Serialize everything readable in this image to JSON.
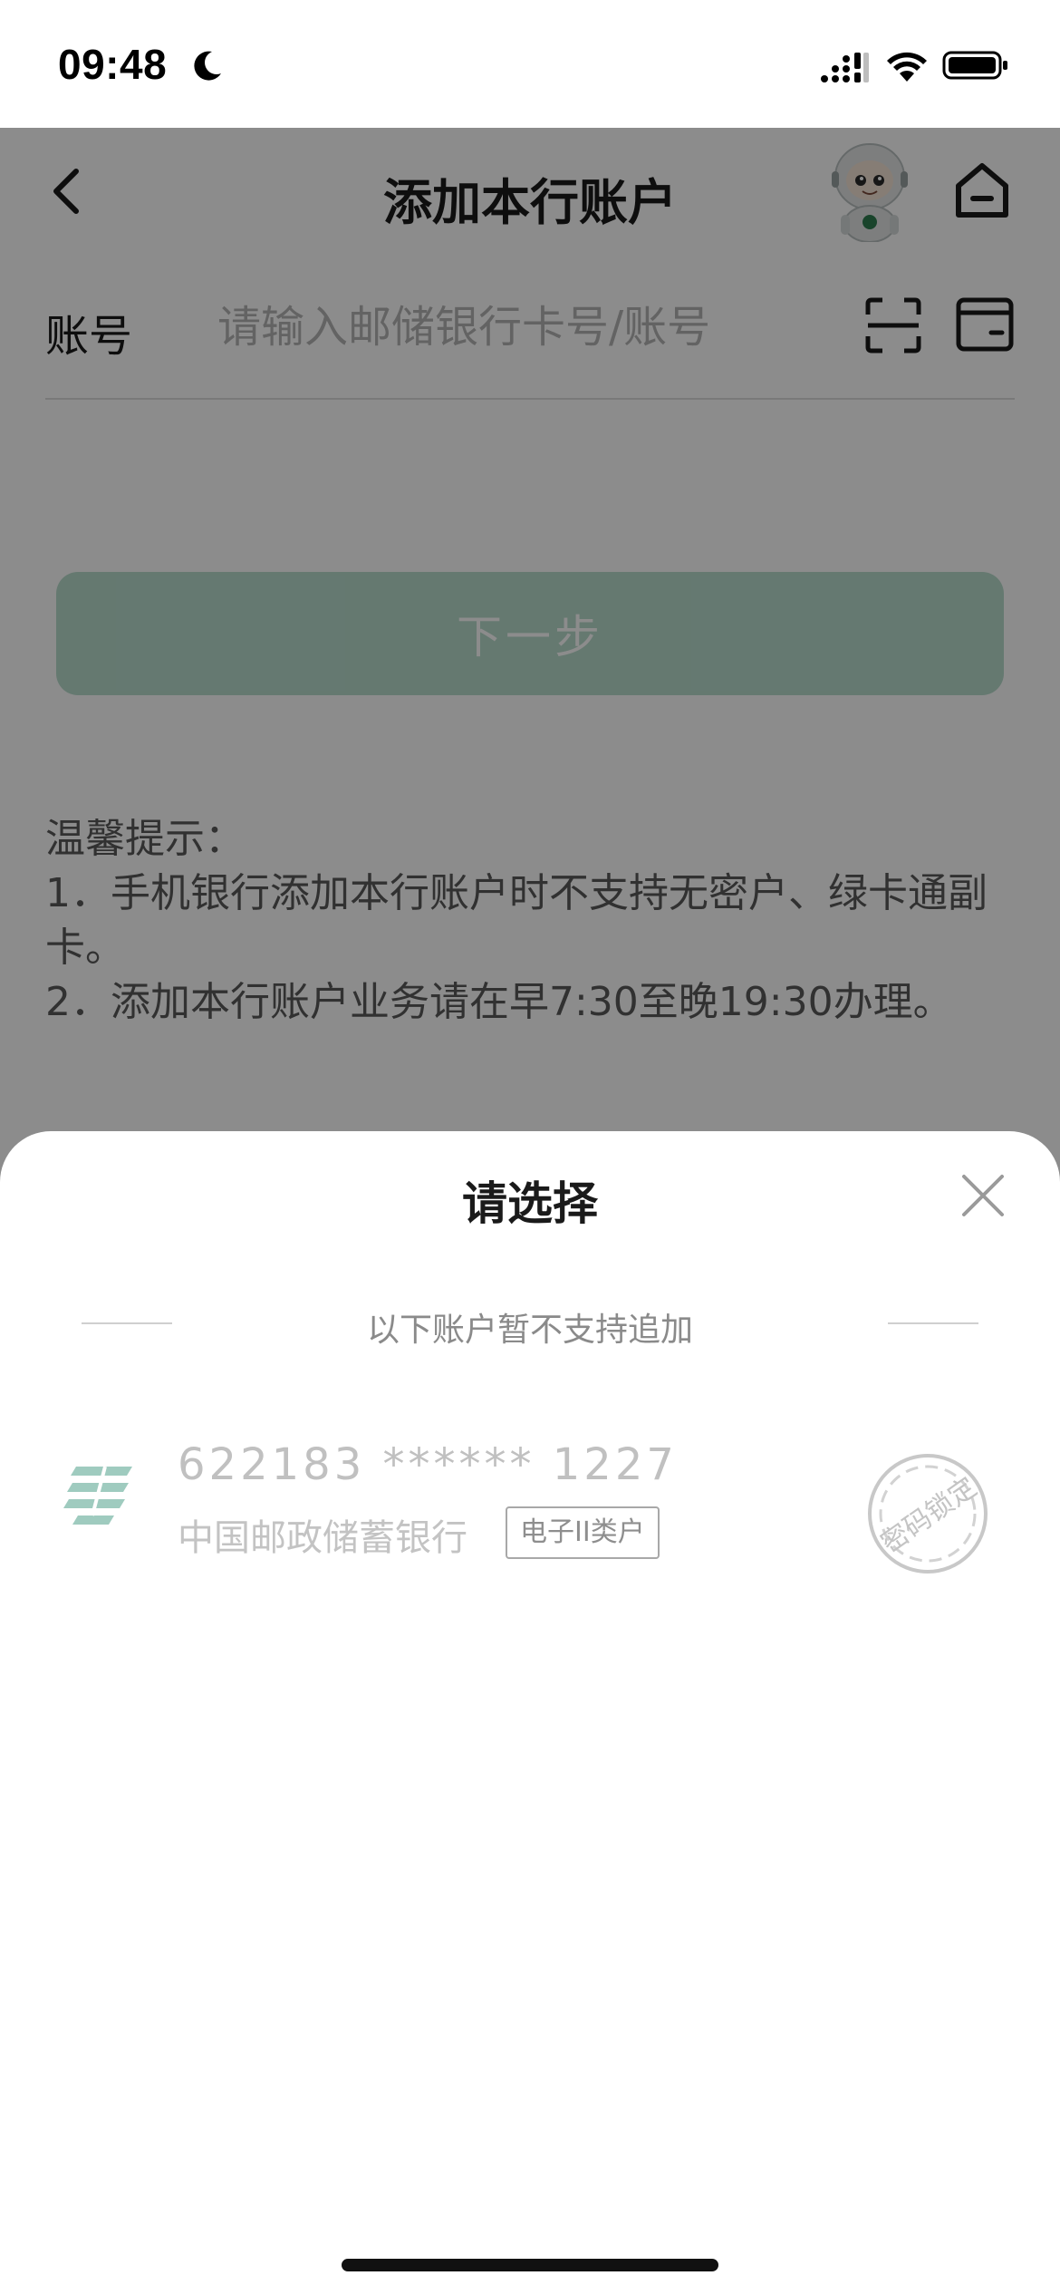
{
  "status_bar": {
    "time": "09:48"
  },
  "nav": {
    "title": "添加本行账户"
  },
  "form": {
    "account_label": "账号",
    "account_placeholder": "请输入邮储银行卡号/账号",
    "next_label": "下一步"
  },
  "tips": {
    "heading": "温馨提示：",
    "item1": "1．手机银行添加本行账户时不支持无密户、绿卡通副卡。",
    "item2": "2．添加本行账户业务请在早7:30至晚19:30办理。"
  },
  "sheet": {
    "title": "请选择",
    "section_note": "以下账户暂不支持追加",
    "accounts": [
      {
        "card_number": "622183 ****** 1227",
        "bank_name": "中国邮政储蓄银行",
        "tag": "电子II类户",
        "stamp": "密码锁定"
      }
    ]
  },
  "colors": {
    "brand_green": "#007a4b",
    "button_green_disabled": "#b8dccd",
    "logo_green": "#9fcbbf"
  }
}
